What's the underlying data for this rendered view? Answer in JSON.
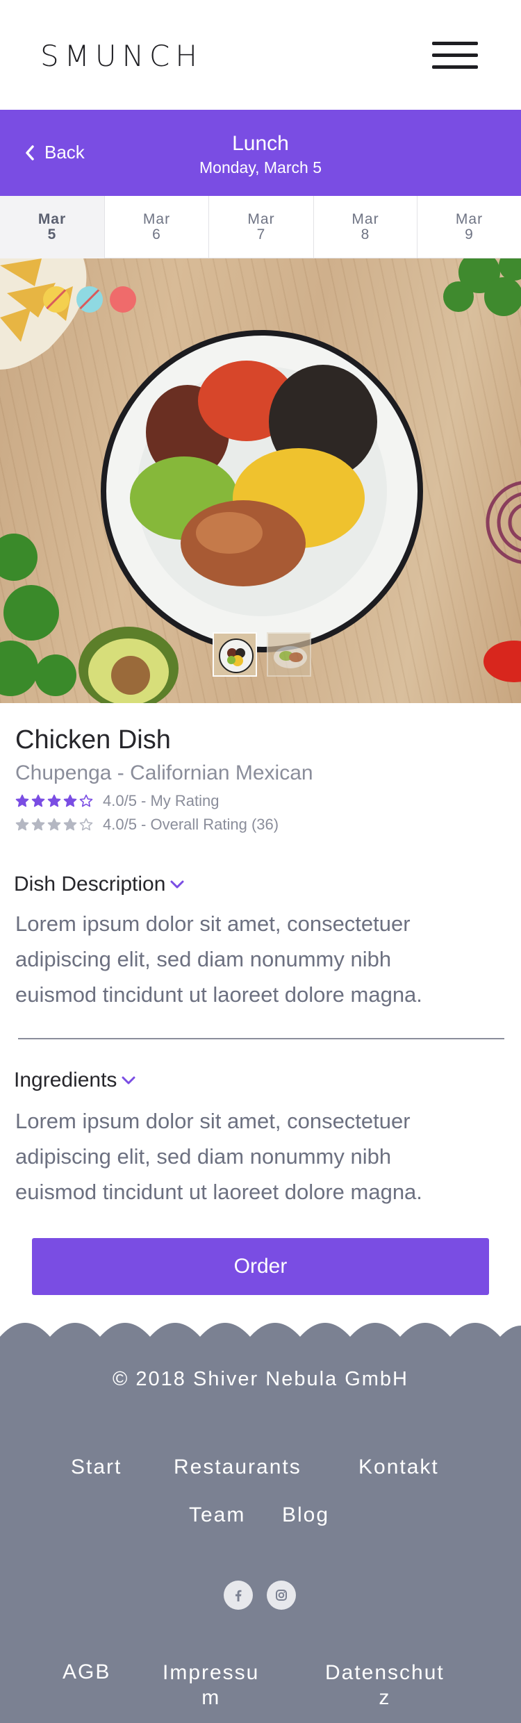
{
  "header": {
    "logo": "SMUNCH",
    "menu_icon": "hamburger-menu-icon"
  },
  "daybar": {
    "back_label": "Back",
    "meal": "Lunch",
    "date": "Monday, March 5"
  },
  "date_tabs": [
    {
      "month": "Mar",
      "day": "5",
      "active": true
    },
    {
      "month": "Mar",
      "day": "6",
      "active": false
    },
    {
      "month": "Mar",
      "day": "7",
      "active": false
    },
    {
      "month": "Mar",
      "day": "8",
      "active": false
    },
    {
      "month": "Mar",
      "day": "9",
      "active": false
    }
  ],
  "hero": {
    "diet_icons": [
      "no-gluten-icon",
      "no-lactose-icon",
      "spicy-icon"
    ],
    "thumbnail_count": 2,
    "selected_thumbnail": 1
  },
  "dish": {
    "name": "Chicken Dish",
    "restaurant": "Chupenga - Californian Mexican",
    "my_rating": {
      "stars": 4,
      "max": 5,
      "text": "4.0/5 - My Rating"
    },
    "overall_rating": {
      "stars": 4,
      "max": 5,
      "text": "4.0/5 - Overall Rating (36)"
    }
  },
  "sections": {
    "description_title": "Dish Description",
    "description_lines": [
      "Lorem ipsum dolor sit amet, consectetuer",
      "adipiscing elit, sed diam nonummy nibh",
      "euismod tincidunt ut laoreet dolore magna."
    ],
    "ingredients_title": "Ingredients",
    "ingredients_lines": [
      "Lorem ipsum dolor sit amet, consectetuer",
      "adipiscing elit, sed diam nonummy nibh",
      "euismod tincidunt ut laoreet dolore magna."
    ]
  },
  "order_label": "Order",
  "footer": {
    "copyright": "© 2018 Shiver Nebula GmbH",
    "links": {
      "start": "Start",
      "restaurants": "Restaurants",
      "kontakt": "Kontakt",
      "team": "Team",
      "blog": "Blog"
    },
    "social_icons": [
      "facebook-icon",
      "instagram-icon"
    ],
    "legal": {
      "agb": "AGB",
      "impressum_line1": "Impressu",
      "impressum_line2": "m",
      "datenschutz_line1": "Datenschut",
      "datenschutz_line2": "z"
    }
  },
  "colors": {
    "accent": "#7a4de3",
    "footer_bg": "#7b8192",
    "muted_text": "#8a8d9a",
    "star_active": "#7a4de3",
    "star_inactive": "#b4b7c2"
  }
}
